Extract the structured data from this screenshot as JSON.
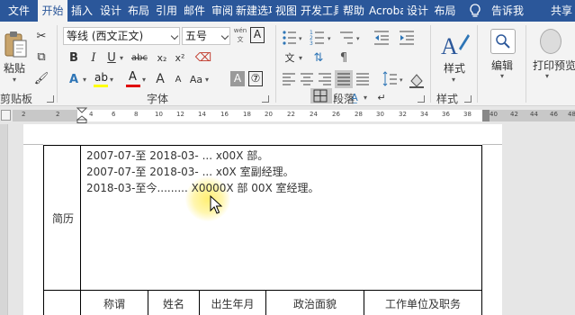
{
  "tabs": [
    "文件",
    "开始",
    "插入",
    "设计",
    "布局",
    "引用",
    "邮件",
    "审阅",
    "新建选项卡",
    "视图",
    "开发工具",
    "帮助",
    "Acrobat",
    "设计",
    "布局"
  ],
  "active_tab_index": 1,
  "tell_me": "告诉我",
  "share": "共享",
  "clipboard": {
    "paste_label": "粘贴",
    "group_label": "剪贴板"
  },
  "font": {
    "font_name": "等线 (西文正文)",
    "font_size": "五号",
    "wen_label": "wén\n文",
    "bold": "B",
    "italic": "I",
    "underline": "U",
    "strike": "abc",
    "subscript": "x₂",
    "superscript": "x²",
    "text_effects": "A",
    "highlight": "ab",
    "font_color": "A",
    "grow": "A",
    "shrink": "A",
    "case": "Aa",
    "char_border": "A",
    "char_shade": "A",
    "group_label": "字体"
  },
  "paragraph": {
    "group_label": "段落"
  },
  "styles": {
    "button_label": "样式",
    "group_label": "样式"
  },
  "editing": {
    "button_label": "编辑"
  },
  "print_preview": {
    "button_label": "打印预览"
  },
  "ruler": {
    "left_ticks": [
      "2",
      "2"
    ],
    "ticks": [
      "4",
      "6",
      "8",
      "10",
      "12",
      "14",
      "16",
      "18",
      "20",
      "22",
      "24",
      "26",
      "28",
      "30",
      "32",
      "34",
      "36",
      "38"
    ],
    "right_ticks": [
      "40",
      "42",
      "44",
      "46",
      "48"
    ]
  },
  "document": {
    "resume_label": "简历",
    "resume_lines": [
      "2007-07-至 2018-03- ... x00X 部。",
      "2007-07-至 2018-03- ... x0X 室副经理。",
      "2018-03-至今......... X0000X 部 00X 室经理。"
    ],
    "family_headers": [
      "称谓",
      "姓名",
      "出生年月",
      "政治面貌",
      "工作单位及职务"
    ]
  },
  "colors": {
    "accent": "#2b579a",
    "ribbon": "#f3f3f3",
    "highlight_glow": "#ffec5a"
  }
}
